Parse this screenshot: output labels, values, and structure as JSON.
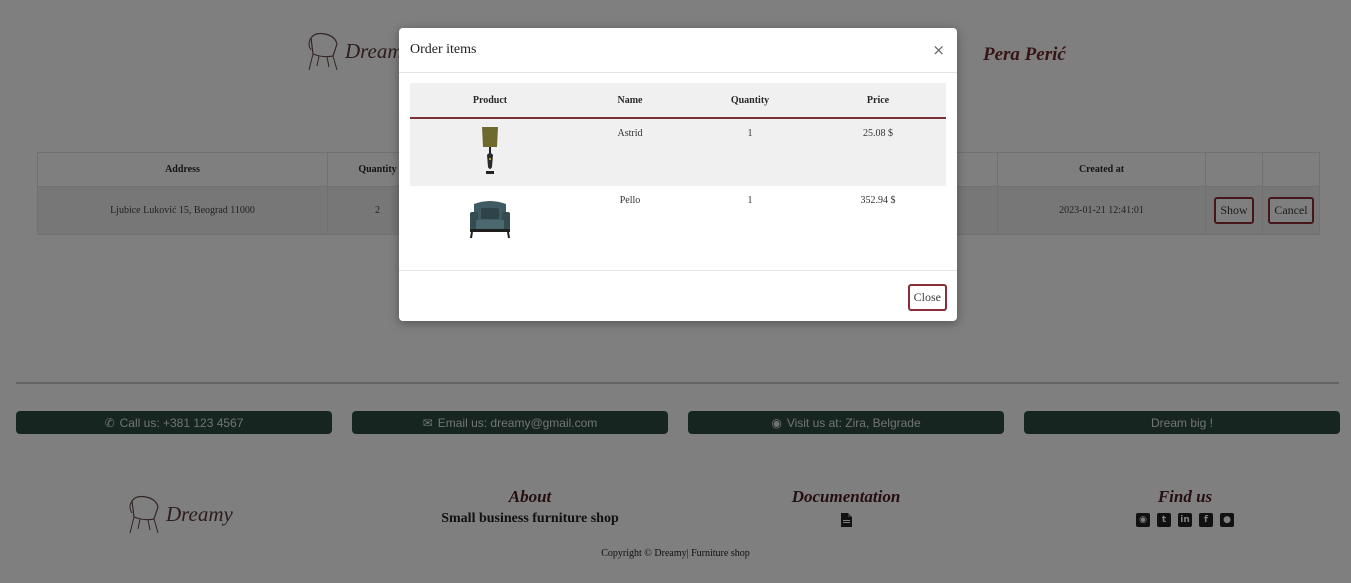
{
  "header": {
    "logo_text": "Dreamy",
    "user_name": "Pera Perić"
  },
  "orders_table": {
    "headers": [
      "Address",
      "Quantity",
      "",
      "Created at",
      "",
      ""
    ],
    "rows": [
      {
        "address": "Ljubice Luković 15, Beograd 11000",
        "quantity": "2",
        "created_at": "2023-01-21 12:41:01",
        "show_label": "Show",
        "cancel_label": "Cancel"
      }
    ]
  },
  "modal": {
    "title": "Order items",
    "close_x": "×",
    "headers": [
      "Product",
      "Name",
      "Quantity",
      "Price"
    ],
    "rows": [
      {
        "product_icon": "lamp-image",
        "name": "Astrid",
        "quantity": "1",
        "price": "25.08 $"
      },
      {
        "product_icon": "armchair-image",
        "name": "Pello",
        "quantity": "1",
        "price": "352.94 $"
      }
    ],
    "close_label": "Close"
  },
  "contact_bar": [
    {
      "icon": "phone-icon",
      "text": "Call us: +381 123 4567"
    },
    {
      "icon": "envelope-icon",
      "text": "Email us: dreamy@gmail.com"
    },
    {
      "icon": "map-marker-icon",
      "text": "Visit us at: Zira, Belgrade"
    },
    {
      "icon": "",
      "text": "Dream big !"
    }
  ],
  "footer": {
    "logo_text": "Dreamy",
    "about_title": "About",
    "about_text": "Small business furniture shop",
    "documentation_title": "Documentation",
    "find_us_title": "Find us",
    "social_icons": [
      "instagram-icon",
      "twitter-icon",
      "linkedin-icon",
      "facebook-icon",
      "github-icon"
    ],
    "copyright": "Copyright © Dreamy| Furniture shop"
  },
  "colors": {
    "accent": "#8a2e37",
    "footer_bar": "#2f4a40",
    "overlay": "rgba(0,0,0,0.5)"
  }
}
